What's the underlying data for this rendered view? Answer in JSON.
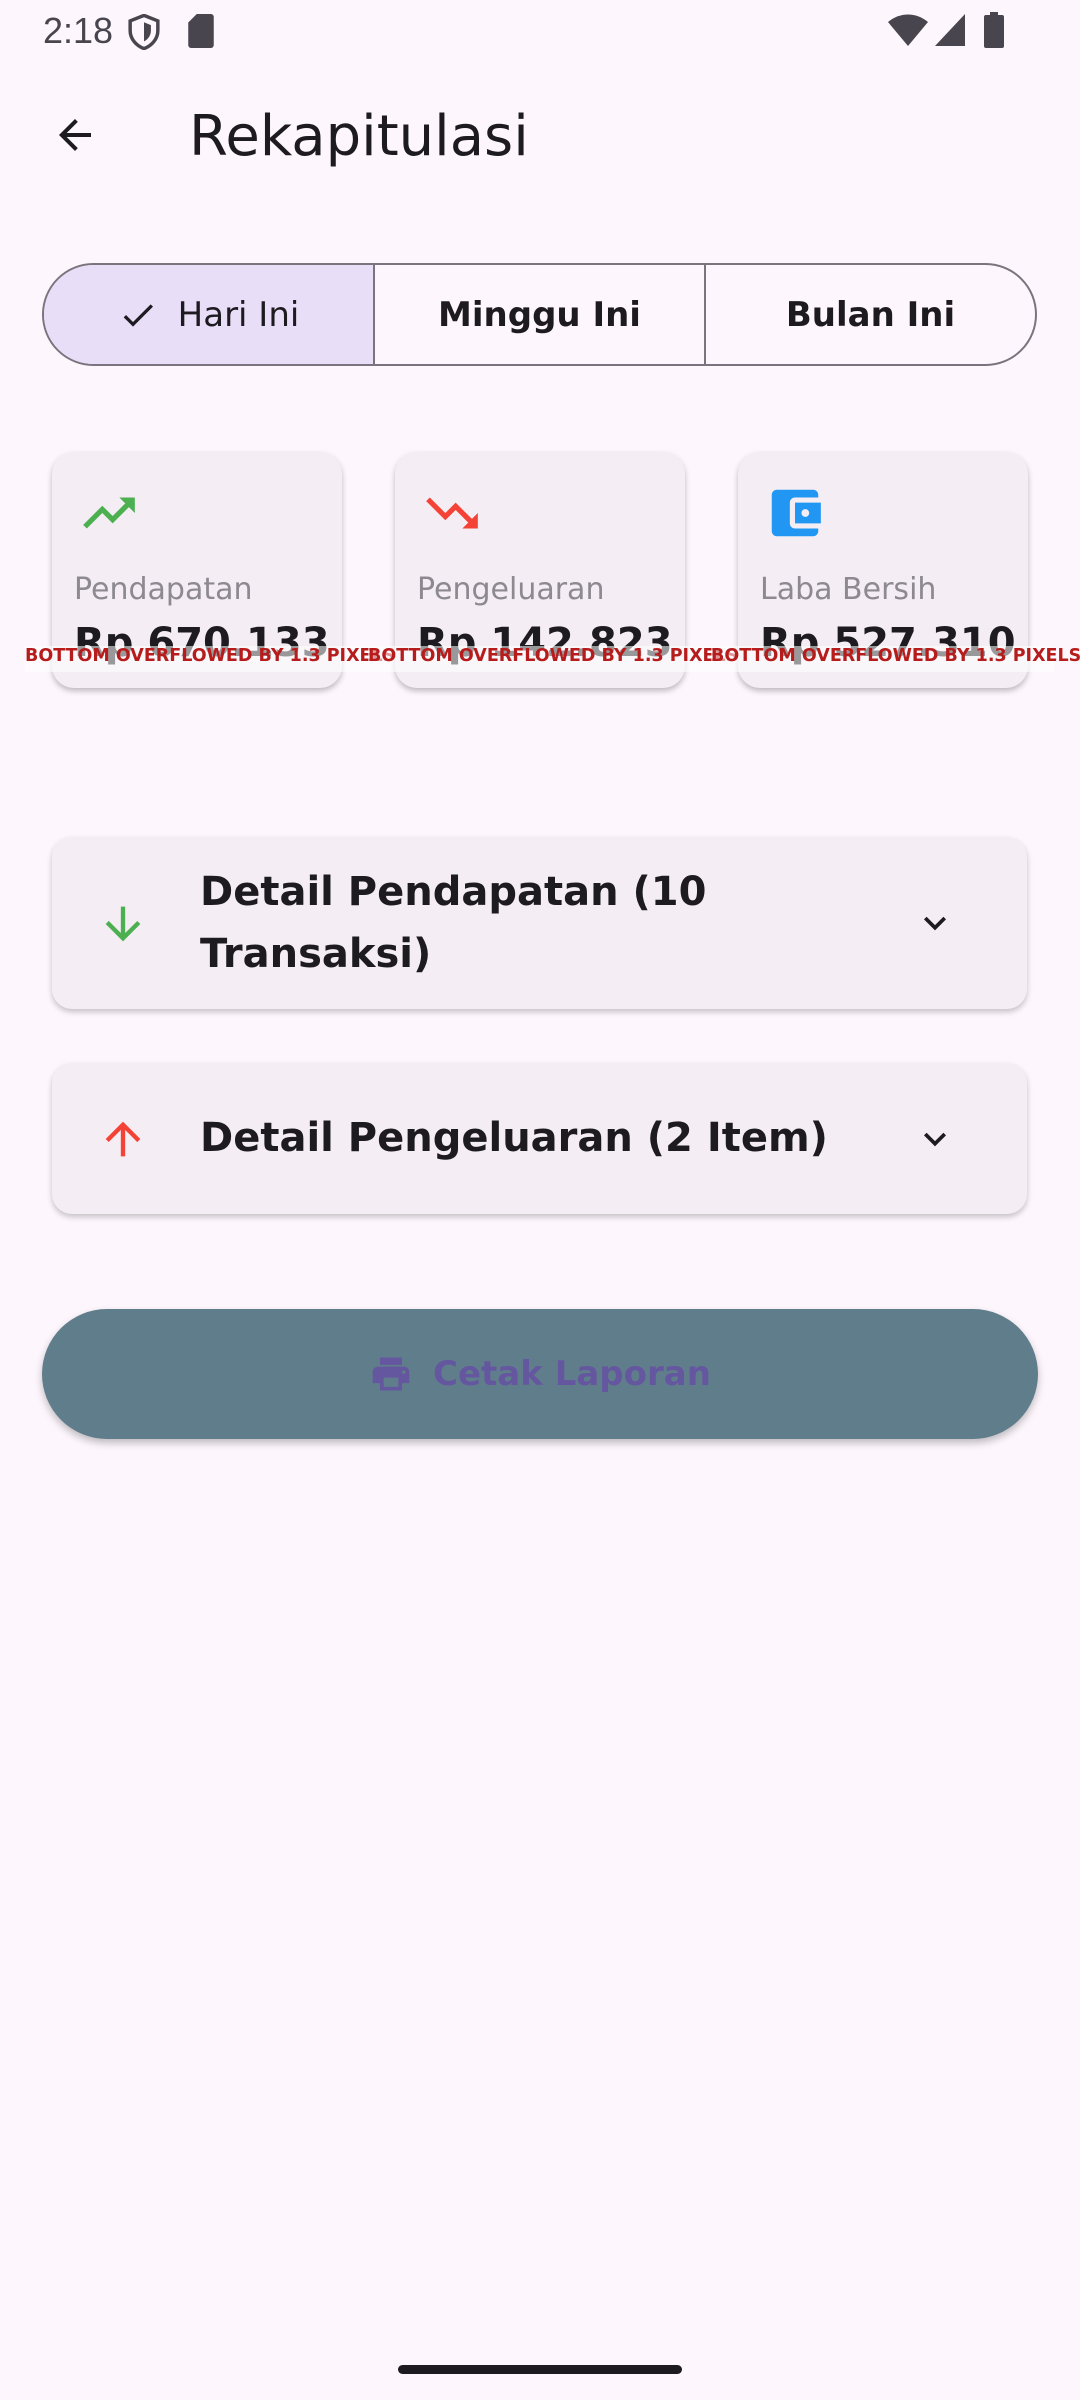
{
  "status_bar": {
    "time": "2:18"
  },
  "app_bar": {
    "title": "Rekapitulasi",
    "back_icon": "arrow-back-icon"
  },
  "period_selector": {
    "options": [
      "Hari Ini",
      "Minggu Ini",
      "Bulan Ini"
    ],
    "selected": "Hari Ini"
  },
  "stats": [
    {
      "label": "Pendapatan",
      "value": "Rp 670.133",
      "icon": "trending-up-icon",
      "color": "#4caf50"
    },
    {
      "label": "Pengeluaran",
      "value": "Rp 142.823",
      "icon": "trending-down-icon",
      "color": "#f44336"
    },
    {
      "label": "Laba Bersih",
      "value": "Rp 527.310",
      "icon": "wallet-icon",
      "color": "#2196f3"
    }
  ],
  "overflow_warning": "BOTTOM OVERFLOWED BY 1.3 PIXELS",
  "details": [
    {
      "title": "Detail Pendapatan (10 Transaksi)",
      "icon": "arrow-down-icon",
      "color": "#4caf50"
    },
    {
      "title": "Detail Pengeluaran (2 Item)",
      "icon": "arrow-up-icon",
      "color": "#f44336"
    }
  ],
  "print_button": {
    "label": "Cetak Laporan",
    "icon": "print-icon"
  }
}
